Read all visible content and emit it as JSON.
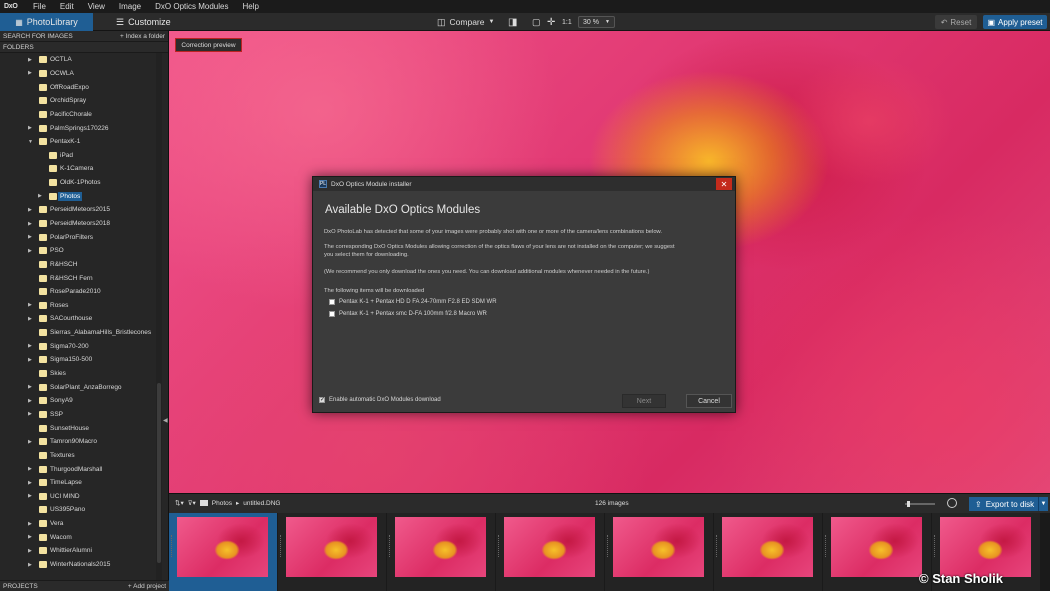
{
  "menubar": {
    "logo": "DxO",
    "items": [
      "File",
      "Edit",
      "View",
      "Image",
      "DxO Optics Modules",
      "Help"
    ]
  },
  "toolbar": {
    "tabs": [
      {
        "label": "PhotoLibrary",
        "active": true
      },
      {
        "label": "Customize",
        "active": false
      }
    ],
    "compare_label": "Compare",
    "one_to_one": "1:1",
    "zoom": "30 %",
    "reset_label": "Reset",
    "apply_preset_label": "Apply preset"
  },
  "sidebar": {
    "search_label": "SEARCH FOR IMAGES",
    "index_label": "+ Index a folder",
    "folders_label": "FOLDERS",
    "projects_label": "PROJECTS",
    "add_project_label": "+ Add project",
    "folders": [
      {
        "name": "OCTLA",
        "level": 0,
        "arrow": "▶"
      },
      {
        "name": "OCWLA",
        "level": 0,
        "arrow": "▶"
      },
      {
        "name": "OffRoadExpo",
        "level": 0,
        "arrow": ""
      },
      {
        "name": "OrchidSpray",
        "level": 0,
        "arrow": ""
      },
      {
        "name": "PacificChorale",
        "level": 0,
        "arrow": ""
      },
      {
        "name": "PalmSprings170226",
        "level": 0,
        "arrow": "▶"
      },
      {
        "name": "PentaxK-1",
        "level": 0,
        "arrow": "▼"
      },
      {
        "name": "iPad",
        "level": 1,
        "arrow": ""
      },
      {
        "name": "K-1Camera",
        "level": 1,
        "arrow": ""
      },
      {
        "name": "OldK-1Photos",
        "level": 1,
        "arrow": ""
      },
      {
        "name": "Photos",
        "level": 1,
        "arrow": "▶",
        "selected": true
      },
      {
        "name": "PerseidMeteors2015",
        "level": 0,
        "arrow": "▶"
      },
      {
        "name": "PerseidMeteors2018",
        "level": 0,
        "arrow": "▶"
      },
      {
        "name": "PolarProFilters",
        "level": 0,
        "arrow": "▶"
      },
      {
        "name": "PSO",
        "level": 0,
        "arrow": "▶"
      },
      {
        "name": "R&HSCH",
        "level": 0,
        "arrow": ""
      },
      {
        "name": "R&HSCH Fern",
        "level": 0,
        "arrow": ""
      },
      {
        "name": "RoseParade2010",
        "level": 0,
        "arrow": ""
      },
      {
        "name": "Roses",
        "level": 0,
        "arrow": "▶"
      },
      {
        "name": "SACourthouse",
        "level": 0,
        "arrow": "▶"
      },
      {
        "name": "Sierras_AlabamaHills_Bristlecones",
        "level": 0,
        "arrow": ""
      },
      {
        "name": "Sigma70-200",
        "level": 0,
        "arrow": "▶"
      },
      {
        "name": "Sigma150-500",
        "level": 0,
        "arrow": "▶"
      },
      {
        "name": "Skies",
        "level": 0,
        "arrow": ""
      },
      {
        "name": "SolarPlant_AnzaBorrego",
        "level": 0,
        "arrow": "▶"
      },
      {
        "name": "SonyA9",
        "level": 0,
        "arrow": "▶"
      },
      {
        "name": "SSP",
        "level": 0,
        "arrow": "▶"
      },
      {
        "name": "SunsetHouse",
        "level": 0,
        "arrow": ""
      },
      {
        "name": "Tamron90Macro",
        "level": 0,
        "arrow": "▶"
      },
      {
        "name": "Textures",
        "level": 0,
        "arrow": ""
      },
      {
        "name": "ThurgoodMarshall",
        "level": 0,
        "arrow": "▶"
      },
      {
        "name": "TimeLapse",
        "level": 0,
        "arrow": "▶"
      },
      {
        "name": "UCI MIND",
        "level": 0,
        "arrow": "▶"
      },
      {
        "name": "US395Pano",
        "level": 0,
        "arrow": ""
      },
      {
        "name": "Vera",
        "level": 0,
        "arrow": "▶"
      },
      {
        "name": "Wacom",
        "level": 0,
        "arrow": "▶"
      },
      {
        "name": "WhittierAlumni",
        "level": 0,
        "arrow": "▶"
      },
      {
        "name": "WinterNationals2015",
        "level": 0,
        "arrow": "▶"
      }
    ]
  },
  "viewer": {
    "correction_preview_label": "Correction preview"
  },
  "dialog": {
    "title": "DxO Optics Module installer",
    "heading": "Available DxO Optics Modules",
    "para1": "DxO PhotoLab has detected that some of your images were probably shot with one or more of the camera/lens combinations below.",
    "para2a": "The corresponding DxO Optics Modules allowing correction of the optics flaws of your lens are not installed on the computer; we suggest",
    "para2b": "you select them for downloading.",
    "para3": "(We recommend you only download the ones you need. You can download additional modules whenever needed in the future.)",
    "list_label": "The following items will be downloaded",
    "items": [
      {
        "label": "Pentax K-1 + Pentax HD D FA 24-70mm F2.8 ED SDM WR",
        "checked": false
      },
      {
        "label": "Pentax K-1 + Pentax smc D-FA 100mm f/2.8 Macro WR",
        "checked": false
      }
    ],
    "auto_download_label": "Enable automatic DxO Modules download",
    "auto_download_checked": true,
    "next_label": "Next",
    "cancel_label": "Cancel"
  },
  "filmbar": {
    "path_root": "Photos",
    "path_sep": "▸",
    "path_file": "untitled.DNG",
    "image_count": "126 images",
    "export_label": "Export to disk"
  },
  "filmstrip": {
    "thumbnail_count": 8,
    "selected_index": 0
  },
  "watermark": "© Stan Sholik"
}
